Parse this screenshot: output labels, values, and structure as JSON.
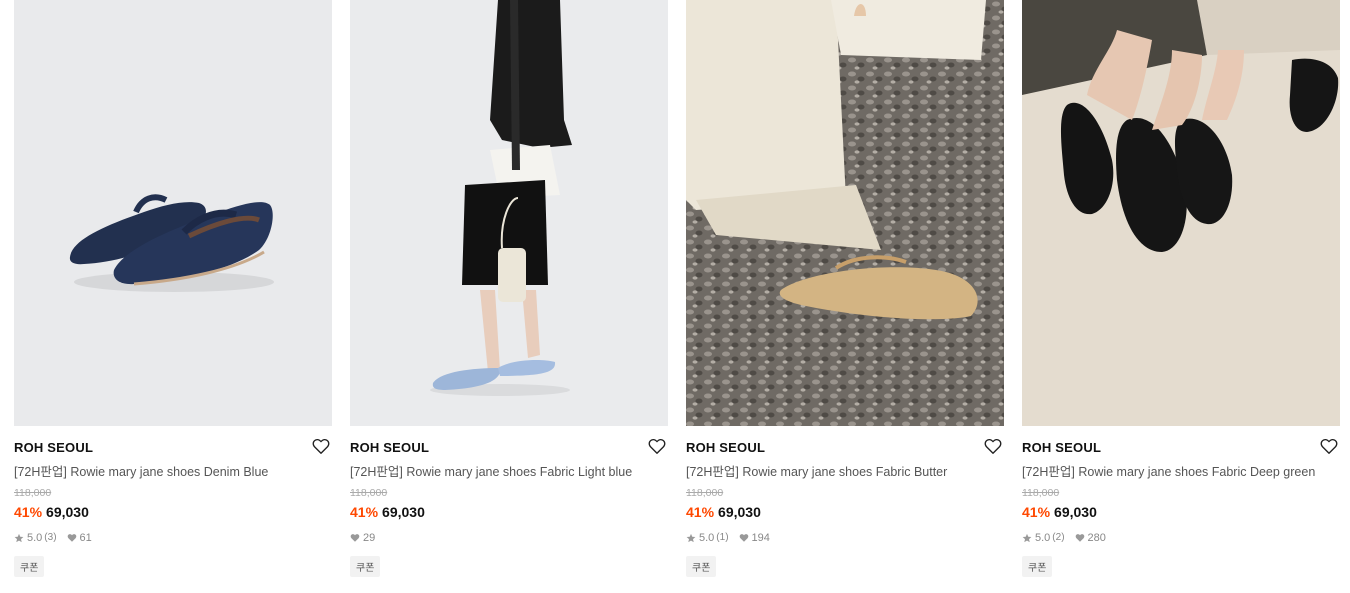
{
  "products": [
    {
      "brand": "ROH SEOUL",
      "name": "[72H판업] Rowie mary jane shoes Denim Blue",
      "original_price": "118,000",
      "discount": "41%",
      "price": "69,030",
      "rating": "5.0",
      "review_count": "(3)",
      "likes": "61",
      "coupon": "쿠폰"
    },
    {
      "brand": "ROH SEOUL",
      "name": "[72H판업] Rowie mary jane shoes Fabric Light blue",
      "original_price": "118,000",
      "discount": "41%",
      "price": "69,030",
      "rating": "",
      "review_count": "",
      "likes": "29",
      "coupon": "쿠폰"
    },
    {
      "brand": "ROH SEOUL",
      "name": "[72H판업] Rowie mary jane shoes Fabric Butter",
      "original_price": "118,000",
      "discount": "41%",
      "price": "69,030",
      "rating": "5.0",
      "review_count": "(1)",
      "likes": "194",
      "coupon": "쿠폰"
    },
    {
      "brand": "ROH SEOUL",
      "name": "[72H판업] Rowie mary jane shoes Fabric Deep green",
      "original_price": "118,000",
      "discount": "41%",
      "price": "69,030",
      "rating": "5.0",
      "review_count": "(2)",
      "likes": "280",
      "coupon": "쿠폰"
    }
  ],
  "colors": {
    "discount": "#ff4800",
    "brand_text": "#111111",
    "name_text": "#555555",
    "meta_text": "#888888"
  },
  "icons": {
    "wishlist": "heart-outline-icon",
    "rating": "star-icon",
    "likes": "heart-filled-icon"
  }
}
